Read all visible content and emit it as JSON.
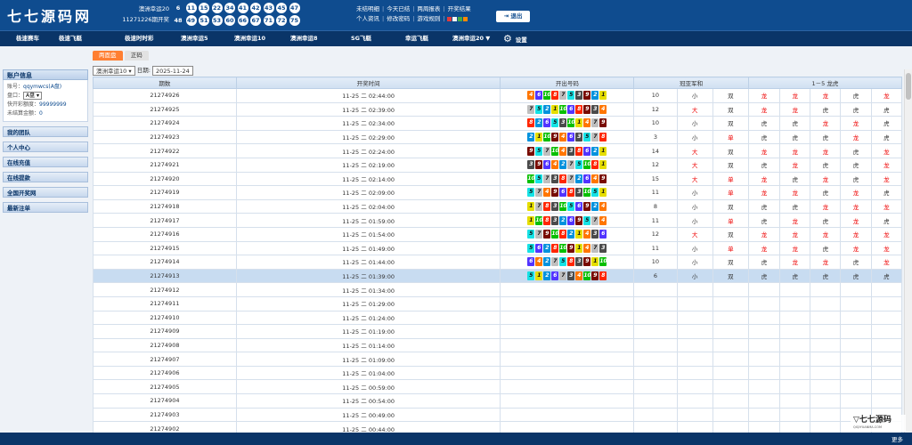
{
  "header": {
    "logo": "七七源码网",
    "lottery_name": "澳洲幸运20",
    "period_line": "11271226期开奖",
    "balls": [
      [
        "6",
        "11",
        "15",
        "22",
        "34",
        "41",
        "42",
        "43",
        "45",
        "47"
      ],
      [
        "48",
        "49",
        "51",
        "53",
        "60",
        "66",
        "67",
        "71",
        "72",
        "75"
      ]
    ],
    "links_row1": [
      "未结明细",
      "今天已结",
      "两周报表",
      "开奖结果"
    ],
    "links_row2": [
      "个人资讯",
      "修改密码",
      "游戏规则"
    ],
    "swatch_colors": [
      "#e33b3b",
      "#f5f5f5",
      "#44aa44",
      "#ff8800"
    ],
    "exit_label": "退出"
  },
  "nav": {
    "items": [
      "极速赛车",
      "极速飞艇",
      "极速时时彩",
      "澳洲幸运5",
      "澳洲幸运10",
      "澳洲幸运8",
      "SG飞艇",
      "幸运飞艇",
      "澳洲幸运20 ▼",
      "设置"
    ]
  },
  "sidebar": {
    "account_header": "账户信息",
    "account_label": "账号：",
    "account_value": "qqymwcs(A盘)",
    "plate_label": "盘口：",
    "plate_value": "A盘",
    "quota_label": "快开彩额度：",
    "quota_value": "99999999",
    "unsettled_label": "未结算金额：",
    "unsettled_value": "0",
    "menu": [
      "我的团队",
      "个人中心",
      "在线充值",
      "在线提款",
      "全国开奖网",
      "最新注单"
    ]
  },
  "tabs": [
    "两面盘",
    "正码"
  ],
  "filter": {
    "game": "澳洲幸运10 ▾",
    "date_label": "日期:",
    "date": "2025-11-24"
  },
  "table": {
    "headers": [
      "期数",
      "开奖时间",
      "开出号码",
      "冠亚军和",
      "1－5 龙虎"
    ],
    "rows": [
      {
        "period": "21274926",
        "time": "11-25 二 02:44:00",
        "nums": [
          4,
          6,
          10,
          8,
          7,
          5,
          3,
          9,
          2,
          1
        ],
        "sum": "10",
        "bs": "小",
        "oe": "双",
        "lh": [
          "龙",
          "龙",
          "龙",
          "虎",
          "龙"
        ]
      },
      {
        "period": "21274925",
        "time": "11-25 二 02:39:00",
        "nums": [
          7,
          5,
          2,
          1,
          10,
          6,
          8,
          9,
          3,
          4
        ],
        "sum": "12",
        "bs": "大",
        "oe": "双",
        "lh": [
          "龙",
          "龙",
          "虎",
          "虎",
          "虎"
        ]
      },
      {
        "period": "21274924",
        "time": "11-25 二 02:34:00",
        "nums": [
          8,
          2,
          6,
          5,
          3,
          10,
          1,
          4,
          7,
          9
        ],
        "sum": "10",
        "bs": "小",
        "oe": "双",
        "lh": [
          "虎",
          "虎",
          "龙",
          "龙",
          "虎"
        ]
      },
      {
        "period": "21274923",
        "time": "11-25 二 02:29:00",
        "nums": [
          2,
          1,
          10,
          9,
          4,
          6,
          3,
          5,
          7,
          8
        ],
        "sum": "3",
        "bs": "小",
        "oe": "单",
        "lh": [
          "虎",
          "虎",
          "虎",
          "龙",
          "虎"
        ]
      },
      {
        "period": "21274922",
        "time": "11-25 二 02:24:00",
        "nums": [
          9,
          5,
          7,
          10,
          4,
          3,
          8,
          6,
          2,
          1
        ],
        "sum": "14",
        "bs": "大",
        "oe": "双",
        "lh": [
          "龙",
          "龙",
          "龙",
          "虎",
          "龙"
        ]
      },
      {
        "period": "21274921",
        "time": "11-25 二 02:19:00",
        "nums": [
          3,
          9,
          6,
          4,
          2,
          7,
          5,
          10,
          8,
          1
        ],
        "sum": "12",
        "bs": "大",
        "oe": "双",
        "lh": [
          "虎",
          "龙",
          "虎",
          "虎",
          "龙"
        ]
      },
      {
        "period": "21274920",
        "time": "11-25 二 02:14:00",
        "nums": [
          10,
          5,
          7,
          3,
          8,
          7,
          2,
          6,
          4,
          9
        ],
        "sum": "15",
        "bs": "大",
        "oe": "单",
        "lh": [
          "龙",
          "虎",
          "龙",
          "虎",
          "龙"
        ]
      },
      {
        "period": "21274919",
        "time": "11-25 二 02:09:00",
        "nums": [
          5,
          7,
          4,
          9,
          6,
          8,
          3,
          10,
          5,
          1
        ],
        "sum": "11",
        "bs": "小",
        "oe": "单",
        "lh": [
          "龙",
          "龙",
          "虎",
          "龙",
          "虎"
        ]
      },
      {
        "period": "21274918",
        "time": "11-25 二 02:04:00",
        "nums": [
          1,
          7,
          8,
          3,
          10,
          5,
          6,
          9,
          2,
          4
        ],
        "sum": "8",
        "bs": "小",
        "oe": "双",
        "lh": [
          "虎",
          "虎",
          "龙",
          "龙",
          "龙"
        ]
      },
      {
        "period": "21274917",
        "time": "11-25 二 01:59:00",
        "nums": [
          1,
          10,
          8,
          3,
          2,
          6,
          9,
          5,
          7,
          4
        ],
        "sum": "11",
        "bs": "小",
        "oe": "单",
        "lh": [
          "虎",
          "龙",
          "虎",
          "龙",
          "虎"
        ]
      },
      {
        "period": "21274916",
        "time": "11-25 二 01:54:00",
        "nums": [
          5,
          7,
          9,
          10,
          8,
          2,
          1,
          4,
          3,
          6
        ],
        "sum": "12",
        "bs": "大",
        "oe": "双",
        "lh": [
          "龙",
          "龙",
          "龙",
          "龙",
          "龙"
        ]
      },
      {
        "period": "21274915",
        "time": "11-25 二 01:49:00",
        "nums": [
          5,
          6,
          2,
          8,
          10,
          9,
          1,
          4,
          7,
          3
        ],
        "sum": "11",
        "bs": "小",
        "oe": "单",
        "lh": [
          "龙",
          "龙",
          "虎",
          "龙",
          "龙"
        ]
      },
      {
        "period": "21274914",
        "time": "11-25 二 01:44:00",
        "nums": [
          6,
          4,
          2,
          7,
          5,
          8,
          3,
          9,
          1,
          10
        ],
        "sum": "10",
        "bs": "小",
        "oe": "双",
        "lh": [
          "虎",
          "龙",
          "龙",
          "虎",
          "龙"
        ]
      },
      {
        "period": "21274913",
        "time": "11-25 二 01:39:00",
        "nums": [
          5,
          1,
          2,
          6,
          7,
          3,
          4,
          10,
          9,
          8
        ],
        "sum": "6",
        "bs": "小",
        "oe": "双",
        "lh": [
          "虎",
          "虎",
          "虎",
          "虎",
          "虎"
        ],
        "hl": true
      },
      {
        "period": "21274912",
        "time": "11-25 二 01:34:00"
      },
      {
        "period": "21274911",
        "time": "11-25 二 01:29:00"
      },
      {
        "period": "21274910",
        "time": "11-25 二 01:24:00"
      },
      {
        "period": "21274909",
        "time": "11-25 二 01:19:00"
      },
      {
        "period": "21274908",
        "time": "11-25 二 01:14:00"
      },
      {
        "period": "21274907",
        "time": "11-25 二 01:09:00"
      },
      {
        "period": "21274906",
        "time": "11-25 二 01:04:00"
      },
      {
        "period": "21274905",
        "time": "11-25 二 00:59:00"
      },
      {
        "period": "21274904",
        "time": "11-25 二 00:54:00"
      },
      {
        "period": "21274903",
        "time": "11-25 二 00:49:00"
      },
      {
        "period": "21274902",
        "time": "11-25 二 00:44:00"
      }
    ]
  },
  "footer": {
    "more_label": "更多",
    "watermark": "七七源码",
    "watermark_sub": "QIQIYUANMA.COM"
  }
}
